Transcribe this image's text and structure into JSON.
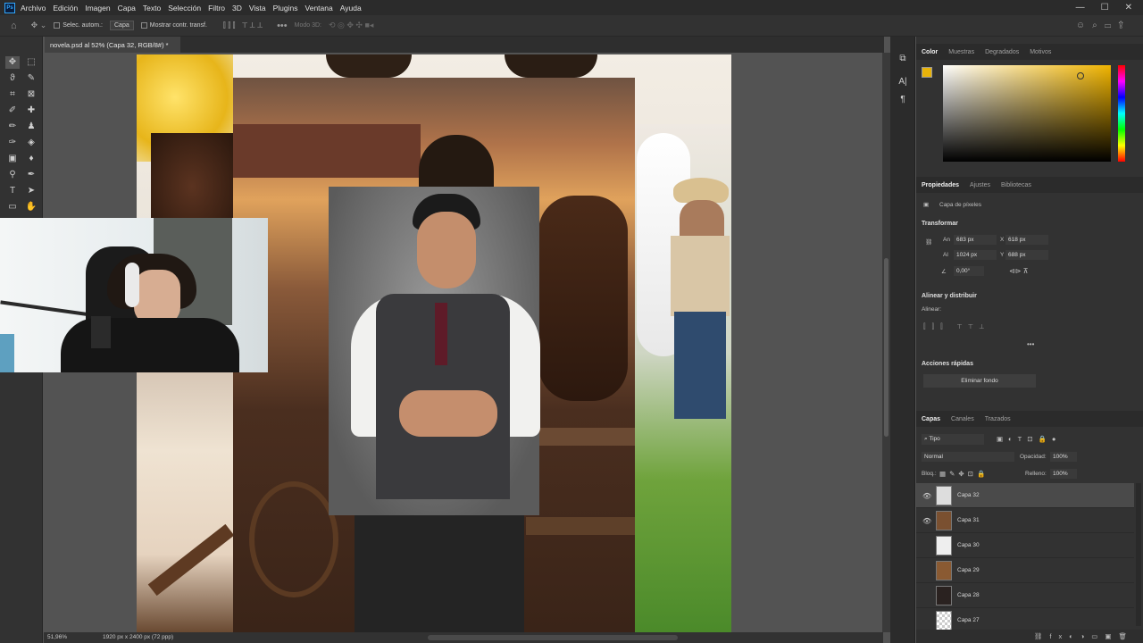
{
  "app": {
    "logo": "Ps"
  },
  "menu": [
    "Archivo",
    "Edición",
    "Imagen",
    "Capa",
    "Texto",
    "Selección",
    "Filtro",
    "3D",
    "Vista",
    "Plugins",
    "Ventana",
    "Ayuda"
  ],
  "options": {
    "auto_select_label": "Selec. autom.:",
    "auto_select_value": "Capa",
    "transform_label": "Mostrar contr. transf.",
    "mode_3d_label": "Modo 3D:"
  },
  "document": {
    "tab_title": "novela.psd al 52% (Capa 32, RGB/8#) *"
  },
  "status": {
    "zoom": "51,96%",
    "doc_info": "1920 px x 2400 px (72 ppp)"
  },
  "color_panel": {
    "tabs": [
      "Color",
      "Muestras",
      "Degradados",
      "Motivos"
    ],
    "foreground": "#e8b30a",
    "background": "#ffffff"
  },
  "properties_panel": {
    "tabs": [
      "Propiedades",
      "Ajustes",
      "Bibliotecas"
    ],
    "layer_type": "Capa de píxeles",
    "transform_title": "Transformar",
    "w_label": "An",
    "w_value": "683 px",
    "x_label": "X",
    "x_value": "618 px",
    "h_label": "Al",
    "h_value": "1024 px",
    "y_label": "Y",
    "y_value": "688 px",
    "angle_value": "0,00°",
    "align_title": "Alinear y distribuir",
    "align_label": "Alinear:",
    "quick_actions_title": "Acciones rápidas",
    "remove_bg_button": "Eliminar fondo"
  },
  "layers_panel": {
    "tabs": [
      "Capas",
      "Canales",
      "Trazados"
    ],
    "filter_value": "Tipo",
    "blend_mode": "Normal",
    "opacity_label": "Opacidad:",
    "opacity_value": "100%",
    "lock_label": "Bloq.:",
    "fill_label": "Relleno:",
    "fill_value": "100%",
    "layers": [
      {
        "name": "Capa 32",
        "visible": true,
        "selected": true
      },
      {
        "name": "Capa 31",
        "visible": true,
        "selected": false
      },
      {
        "name": "Capa 30",
        "visible": false,
        "selected": false
      },
      {
        "name": "Capa 29",
        "visible": false,
        "selected": false
      },
      {
        "name": "Capa 28",
        "visible": false,
        "selected": false
      },
      {
        "name": "Capa 27",
        "visible": false,
        "selected": false
      }
    ]
  }
}
